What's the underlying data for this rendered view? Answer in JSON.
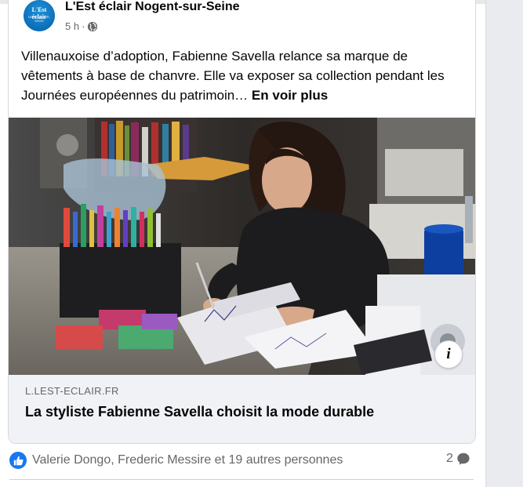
{
  "post": {
    "page_name": "L'Est éclair Nogent-sur-Seine",
    "avatar_text": "L'Est éclair",
    "avatar_subtext": "NOGENT-SUR-SEINE",
    "time": "5 h",
    "separator": "·",
    "privacy_icon": "globe-icon",
    "text": "Villenauxoise d’adoption, Fabienne Savella relance sa marque de vêtements à base de chanvre. Elle va exposer sa collection pendant les Journées européennes du patrimoin…",
    "see_more": "En voir plus",
    "info_icon": "info-icon",
    "info_glyph": "i"
  },
  "link_preview": {
    "domain": "L.LEST-ECLAIR.FR",
    "title": "La styliste Fabienne Savella choisit la mode durable"
  },
  "footer": {
    "reaction_icon": "like-icon",
    "reaction_names": "Valerie Dongo, Frederic Messire et 19 autres personnes",
    "comment_count": "2",
    "comment_icon": "comment-bubble-icon"
  },
  "colors": {
    "accent": "#1877f2",
    "text": "#050505",
    "secondary_text": "#65676b",
    "preview_bg": "#f0f2f5"
  }
}
